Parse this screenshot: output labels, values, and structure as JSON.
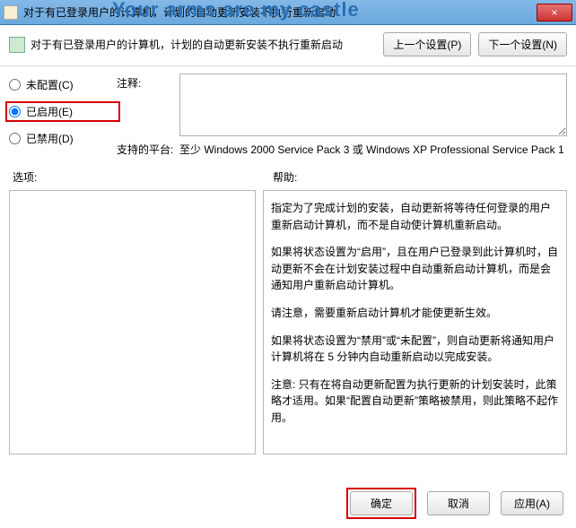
{
  "titlebar": {
    "icon": "policy-icon",
    "title": "对于有已登录用户的计算机，计划的自动更新安装不执行重新启动",
    "overtext": "Your arms are my castle",
    "close": "×"
  },
  "header": {
    "text": "对于有已登录用户的计算机，计划的自动更新安装不执行重新启动",
    "prev": "上一个设置(P)",
    "next": "下一个设置(N)"
  },
  "radios": {
    "not_configured": "未配置(C)",
    "enabled": "已启用(E)",
    "disabled": "已禁用(D)",
    "selected": "enabled"
  },
  "labels": {
    "comment": "注释:",
    "platform": "支持的平台:",
    "options": "选项:",
    "help": "帮助:"
  },
  "platform_value": "至少 Windows 2000 Service Pack 3 或 Windows XP Professional Service Pack 1",
  "help_paragraphs": [
    "指定为了完成计划的安装，自动更新将等待任何登录的用户重新启动计算机，而不是自动使计算机重新启动。",
    "如果将状态设置为“启用”，且在用户已登录到此计算机时，自动更新不会在计划安装过程中自动重新启动计算机，而是会通知用户重新启动计算机。",
    "请注意，需要重新启动计算机才能使更新生效。",
    "如果将状态设置为“禁用”或“未配置”，则自动更新将通知用户计算机将在 5 分钟内自动重新启动以完成安装。",
    "注意: 只有在将自动更新配置为执行更新的计划安装时，此策略才适用。如果“配置自动更新”策略被禁用，则此策略不起作用。"
  ],
  "buttons": {
    "ok": "确定",
    "cancel": "取消",
    "apply": "应用(A)"
  }
}
